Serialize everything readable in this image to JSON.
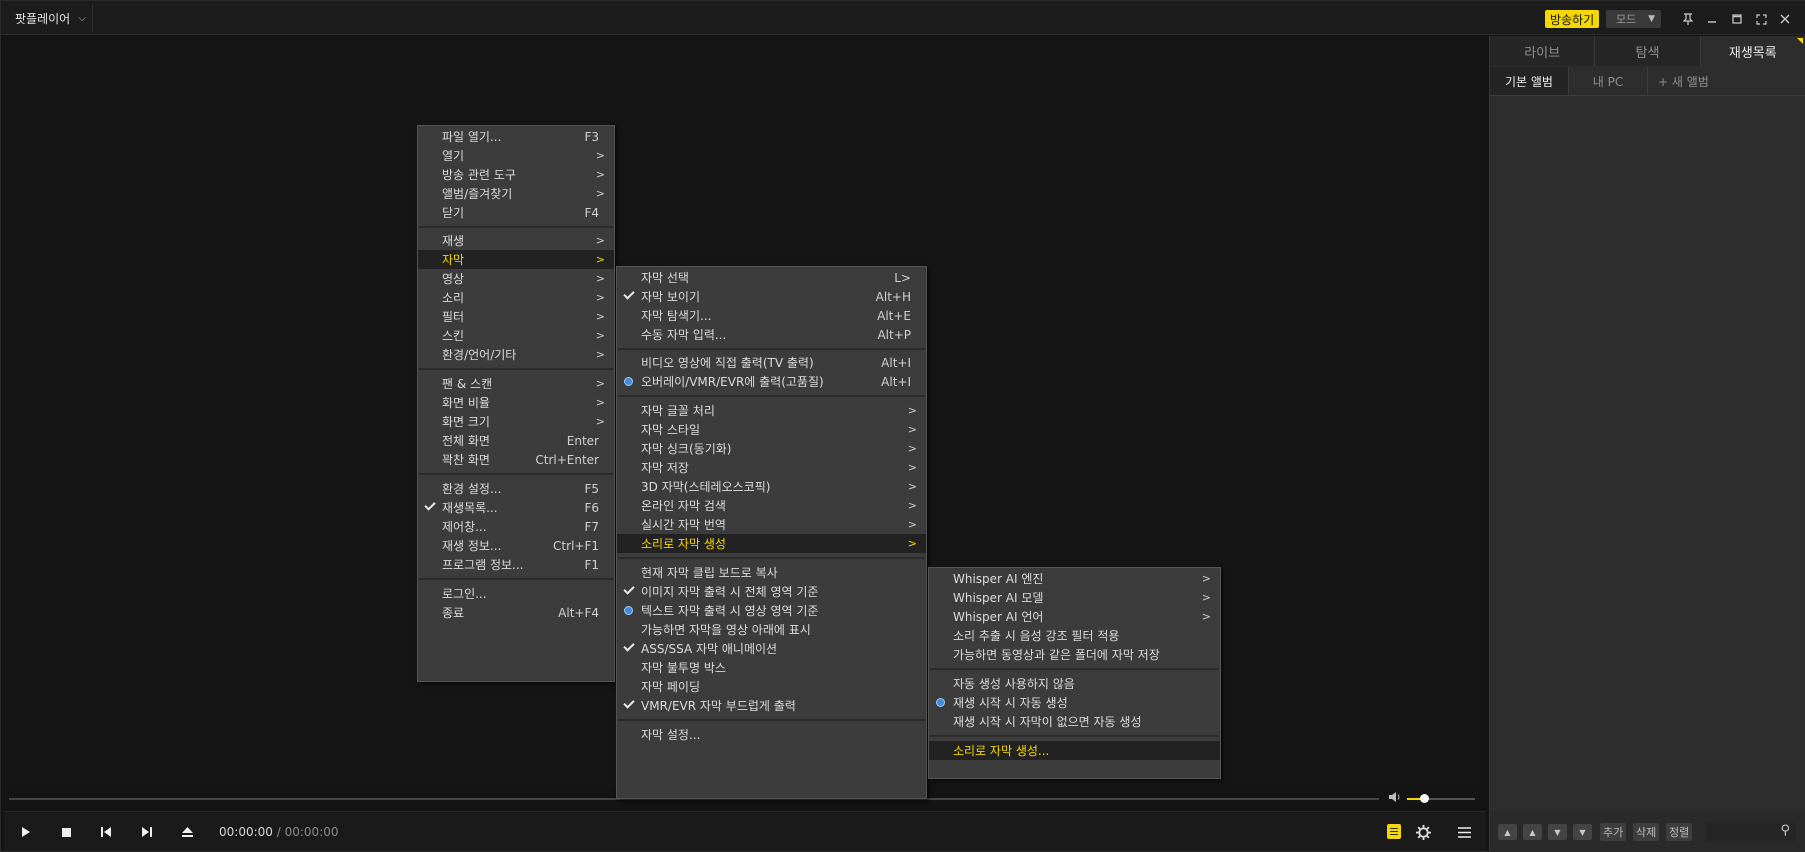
{
  "titlebar": {
    "app_name": "팟플레이어",
    "broadcast": "방송하기",
    "mode": "모드"
  },
  "controls": {
    "current_time": "00:00:00",
    "separator": "/",
    "total_time": "00:00:00",
    "volume_level": 0.25
  },
  "panel": {
    "tabs": [
      "라이브",
      "탐색",
      "재생목록"
    ],
    "subtabs": [
      "기본 앨범",
      "내 PC",
      "+ 새 앨범"
    ],
    "footer_buttons": [
      "추가",
      "삭제",
      "정렬"
    ]
  },
  "main_menu": {
    "items": [
      {
        "label": "파일 열기...",
        "shortcut": "F3"
      },
      {
        "label": "열기",
        "arrow": ">"
      },
      {
        "label": "방송 관련 도구",
        "arrow": ">"
      },
      {
        "label": "앨범/즐겨찾기",
        "arrow": ">"
      },
      {
        "label": "닫기",
        "shortcut": "F4"
      },
      {
        "label": "재생",
        "arrow": ">"
      },
      {
        "label": "자막",
        "arrow": ">"
      },
      {
        "label": "영상",
        "arrow": ">"
      },
      {
        "label": "소리",
        "arrow": ">"
      },
      {
        "label": "필터",
        "arrow": ">"
      },
      {
        "label": "스킨",
        "arrow": ">"
      },
      {
        "label": "환경/언어/기타",
        "arrow": ">"
      },
      {
        "label": "팬 & 스캔",
        "arrow": ">"
      },
      {
        "label": "화면 비율",
        "arrow": ">"
      },
      {
        "label": "화면 크기",
        "arrow": ">"
      },
      {
        "label": "전체 화면",
        "shortcut": "Enter"
      },
      {
        "label": "꽉찬 화면",
        "shortcut": "Ctrl+Enter"
      },
      {
        "label": "환경 설정...",
        "shortcut": "F5"
      },
      {
        "label": "재생목록...",
        "shortcut": "F6"
      },
      {
        "label": "제어창...",
        "shortcut": "F7"
      },
      {
        "label": "재생 정보...",
        "shortcut": "Ctrl+F1"
      },
      {
        "label": "프로그램 정보...",
        "shortcut": "F1"
      },
      {
        "label": "로그인..."
      },
      {
        "label": "종료",
        "shortcut": "Alt+F4"
      }
    ]
  },
  "subtitle_menu": {
    "items": [
      {
        "label": "자막 선택",
        "shortcut": "L>"
      },
      {
        "label": "자막 보이기",
        "shortcut": "Alt+H"
      },
      {
        "label": "자막 탐색기...",
        "shortcut": "Alt+E"
      },
      {
        "label": "수동 자막 입력...",
        "shortcut": "Alt+P"
      },
      {
        "label": "비디오 영상에 직접 출력(TV 출력)",
        "shortcut": "Alt+I"
      },
      {
        "label": "오버레이/VMR/EVR에 출력(고품질)",
        "shortcut": "Alt+I"
      },
      {
        "label": "자막 글꼴 처리",
        "arrow": ">"
      },
      {
        "label": "자막 스타일",
        "arrow": ">"
      },
      {
        "label": "자막 싱크(동기화)",
        "arrow": ">"
      },
      {
        "label": "자막 저장",
        "arrow": ">"
      },
      {
        "label": "3D 자막(스테레오스코픽)",
        "arrow": ">"
      },
      {
        "label": "온라인 자막 검색",
        "arrow": ">"
      },
      {
        "label": "실시간 자막 번역",
        "arrow": ">"
      },
      {
        "label": "소리로 자막 생성",
        "arrow": ">"
      },
      {
        "label": "현재 자막 클립 보드로 복사"
      },
      {
        "label": "이미지 자막 출력 시 전체 영역 기준"
      },
      {
        "label": "텍스트 자막 출력 시 영상 영역 기준"
      },
      {
        "label": "가능하면 자막을 영상 아래에 표시"
      },
      {
        "label": "ASS/SSA 자막 애니메이션"
      },
      {
        "label": "자막 불투명 박스"
      },
      {
        "label": "자막 페이딩"
      },
      {
        "label": "VMR/EVR 자막 부드럽게 출력"
      },
      {
        "label": "자막 설정..."
      }
    ]
  },
  "ai_menu": {
    "items": [
      {
        "label": "Whisper AI 엔진",
        "arrow": ">"
      },
      {
        "label": "Whisper AI 모델",
        "arrow": ">"
      },
      {
        "label": "Whisper AI 언어",
        "arrow": ">"
      },
      {
        "label": "소리 추출 시 음성 강조 필터 적용"
      },
      {
        "label": "가능하면 동영상과 같은 폴더에 자막 저장"
      },
      {
        "label": "자동 생성 사용하지 않음"
      },
      {
        "label": "재생 시작 시 자동 생성"
      },
      {
        "label": "재생 시작 시 자막이 없으면 자동 생성"
      },
      {
        "label": "소리로 자막 생성..."
      }
    ]
  },
  "colors": {
    "accent": "#f5d800",
    "radio": "#3c8ce0",
    "menu_bg": "#3c3c3c",
    "video_bg": "#151515"
  },
  "icons": [
    "chevron-down-icon",
    "pin-icon",
    "minimize-icon",
    "maximize-icon",
    "fullscreen-icon",
    "close-icon",
    "volume-icon",
    "play-icon",
    "stop-icon",
    "previous-icon",
    "next-icon",
    "eject-icon",
    "subtitle-icon",
    "settings-icon",
    "menu-icon",
    "search-icon"
  ]
}
